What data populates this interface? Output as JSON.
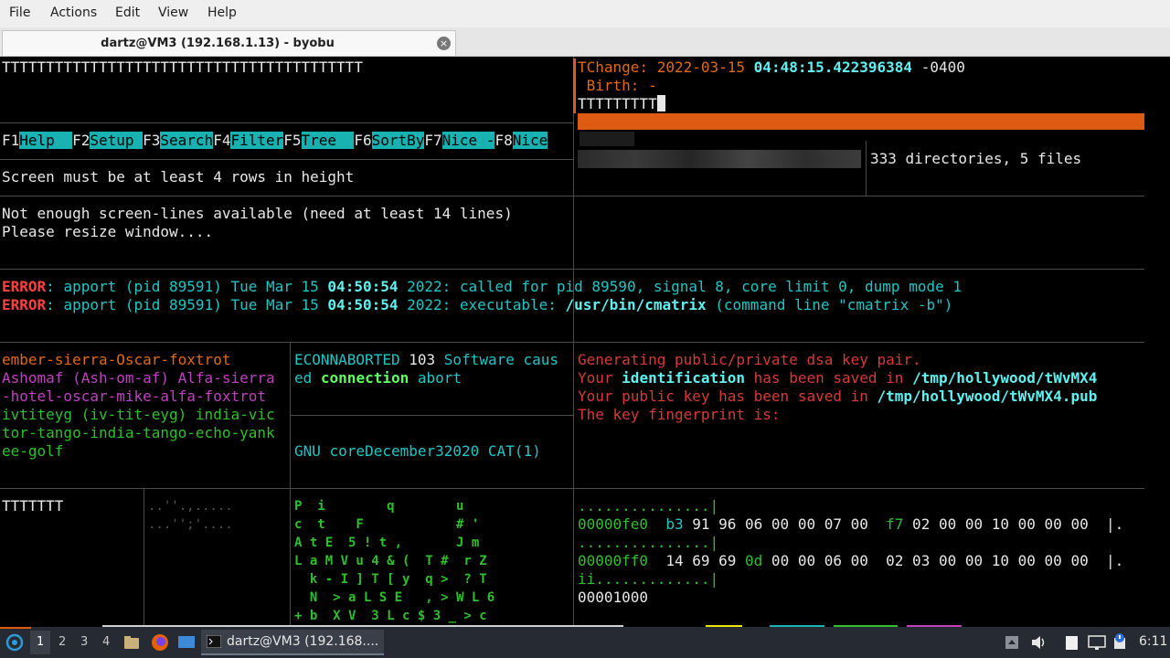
{
  "window": {
    "menu": [
      "File",
      "Actions",
      "Edit",
      "View",
      "Help"
    ],
    "tab_title": "dartz@VM3 (192.168.1.13) - byobu",
    "tab_close": "×"
  },
  "pane_a": {
    "line1": "TTTTTTTTTTTTTTTTTTTTTTTTTTTTTTTTTTTTTTTTT"
  },
  "pane_b": {
    "label": "TChange:",
    "date": "2022-03-15",
    "time": "04:48:15.422396384",
    "tz": "-0400",
    "birth": " Birth: -",
    "input": "TTTTTTTTT"
  },
  "htop": {
    "keys": [
      {
        "k": "F1",
        "l": "Help  "
      },
      {
        "k": "F2",
        "l": "Setup "
      },
      {
        "k": "F3",
        "l": "Search"
      },
      {
        "k": "F4",
        "l": "Filter"
      },
      {
        "k": "F5",
        "l": "Tree  "
      },
      {
        "k": "F6",
        "l": "SortBy"
      },
      {
        "k": "F7",
        "l": "Nice -"
      },
      {
        "k": "F8",
        "l": "Nice"
      }
    ],
    "msg": "Screen must be at least 4 rows in height"
  },
  "tree_summary": "333 directories, 5 files",
  "cmatrix_msg": [
    "Not enough screen-lines available (need at least 14 lines)",
    "Please resize window...."
  ],
  "errors": [
    {
      "tag": "ERROR",
      "pre": ": apport (pid 89591) Tue Mar 15 ",
      "time": "04:50:54",
      "post": " 2022: called for pid 89590, signal 8, core limit 0, dump mode 1"
    },
    {
      "tag": "ERROR",
      "pre": ": apport (pid 89591) Tue Mar 15 ",
      "time": "04:50:54",
      "post2": " 2022: executable: ",
      "path": "/usr/bin/cmatrix",
      "tail": " (command line \"cmatrix -b\")"
    }
  ],
  "phonetic": {
    "l1": "ember-sierra-Oscar-foxtrot",
    "l2": "Ashomaf (Ash-om-af) Alfa-sierra",
    "l3": "-hotel-oscar-mike-alfa-foxtrot",
    "l4": "ivtiteyg (iv-tit-eyg) india-vic",
    "l5": "tor-tango-india-tango-echo-yank",
    "l6": "ee-golf"
  },
  "errno": {
    "code": "ECONNABORTED",
    "num": "103",
    "desc1": "Software caus",
    "desc2a": "ed ",
    "desc2b": "connection",
    "desc2c": " abort",
    "man": "GNU coreDecember32020 CAT(1)"
  },
  "keygen": {
    "l1": "Generating public/private dsa key pair.",
    "l2a": "Your ",
    "l2b": "identification",
    "l2c": " has been saved in ",
    "l2d": "/tmp/hollywood/tWvMX4",
    "l3a": "Your public key has been saved in ",
    "l3b": "/tmp/hollywood/tWvMX4.pub",
    "l4": "The key fingerprint is:"
  },
  "bottom_left": "TTTTTTT",
  "dots": [
    "..''.,.....",
    "...'';'...."
  ],
  "matrix_rows": [
    "P  i        q        u",
    "c  t    F            # '",
    "A t E  5 ! t ,       J m",
    "L a M V u 4 & (  T #  r Z",
    "  k - I ] T [ y  q >  ? T",
    "  N  > a L S E   , > W L 6",
    "+ b  X V  3 L c $ 3 _ > c"
  ],
  "hexdump": {
    "r1": "...............|",
    "r2_off": "00000fe0",
    "r2_a": "  b3",
    "r2_b": " 91 96 06 00 00 07 00  ",
    "r2_c": "f7",
    "r2_d": " 02 00 00 10 00 00 00  |.",
    "r3": "...............|",
    "r4_off": "00000ff0",
    "r4_a": "  14 69 69 ",
    "r4_b": "0d",
    "r4_c": " 00 00 06 00  02 03 00 00 10 00 00 00  |.",
    "r5": "ii.............|",
    "r6": "00001000"
  },
  "taskbar": {
    "workspaces": [
      "1",
      "2",
      "3",
      "4"
    ],
    "task_label": "dartz@VM3 (192.168....",
    "clock": "6:11"
  },
  "colors": {
    "accent_orange": "#dd5b12",
    "cyan_key": "#18b2b2",
    "taskbar": "#262b33"
  }
}
